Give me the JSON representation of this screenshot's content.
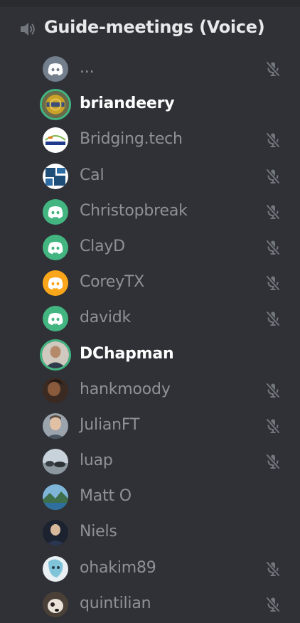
{
  "channel": {
    "name": "Guide-meetings (Voice)",
    "icon": "speaker-icon"
  },
  "colors": {
    "background": "#2f3136",
    "speaking_ring": "#43b581",
    "discord_gray": "#747f8d",
    "discord_green": "#43b581",
    "discord_orange": "#faa61a",
    "muted_text": "#8e9297",
    "active_text": "#ffffff"
  },
  "users": [
    {
      "name": "...",
      "avatar": "discord-gray",
      "muted": true,
      "speaking": false
    },
    {
      "name": "briandeery",
      "avatar": "photo-gold-logo",
      "muted": false,
      "speaking": true
    },
    {
      "name": "Bridging.tech",
      "avatar": "bridging-blockchain-logo",
      "muted": true,
      "speaking": false
    },
    {
      "name": "Cal",
      "avatar": "blue-squares-logo",
      "muted": true,
      "speaking": false
    },
    {
      "name": "Christopbreak",
      "avatar": "discord-green",
      "muted": true,
      "speaking": false
    },
    {
      "name": "ClayD",
      "avatar": "discord-green",
      "muted": true,
      "speaking": false
    },
    {
      "name": "CoreyTX",
      "avatar": "discord-orange",
      "muted": true,
      "speaking": false
    },
    {
      "name": "davidk",
      "avatar": "discord-green",
      "muted": true,
      "speaking": false
    },
    {
      "name": "DChapman",
      "avatar": "photo-man",
      "muted": false,
      "speaking": true
    },
    {
      "name": "hankmoody",
      "avatar": "photo-dark",
      "muted": true,
      "speaking": false
    },
    {
      "name": "JulianFT",
      "avatar": "photo-man-light",
      "muted": true,
      "speaking": false
    },
    {
      "name": "luap",
      "avatar": "photo-rocks",
      "muted": true,
      "speaking": false
    },
    {
      "name": "Matt O",
      "avatar": "photo-landscape",
      "muted": false,
      "speaking": false
    },
    {
      "name": "Niels",
      "avatar": "photo-man-suit",
      "muted": false,
      "speaking": false
    },
    {
      "name": "ohakim89",
      "avatar": "photo-anime",
      "muted": true,
      "speaking": false
    },
    {
      "name": "quintilian",
      "avatar": "photo-dog",
      "muted": true,
      "speaking": false
    }
  ]
}
